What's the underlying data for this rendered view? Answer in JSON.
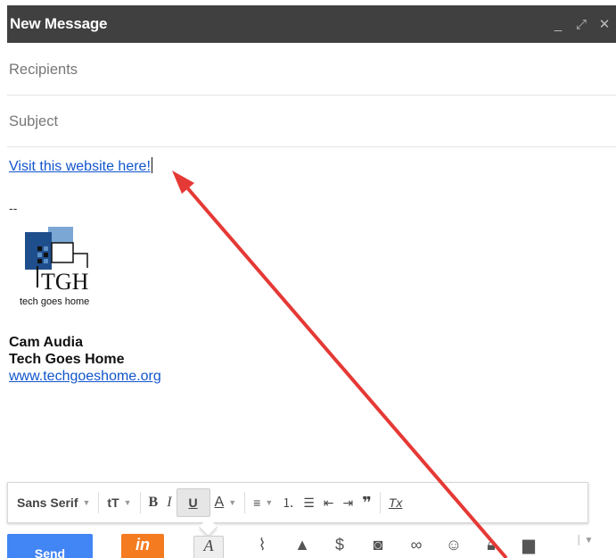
{
  "window": {
    "title": "New Message",
    "controls": {
      "minimize": "_",
      "expand": "⤢",
      "close": "✕"
    }
  },
  "compose": {
    "recipients_placeholder": "Recipients",
    "subject_placeholder": "Subject",
    "link_text": "Visit this website here!"
  },
  "signature": {
    "separator": "--",
    "logo_text": "TGH",
    "logo_subtitle": "tech goes home",
    "name": "Cam Audia",
    "org": "Tech Goes Home",
    "url": "www.techgoeshome.org"
  },
  "format_toolbar": {
    "font": "Sans Serif",
    "size_icon": "tT",
    "bold": "B",
    "italic": "I",
    "underline": "U",
    "text_color": "A",
    "clear_format": "Tx"
  },
  "bottom_toolbar": {
    "send": "Send",
    "in_button": "in",
    "format_toggle": "A",
    "icons": [
      "paperclip-icon",
      "drive-icon",
      "dollar-icon",
      "camera-icon",
      "link-icon",
      "emoji-icon",
      "lock-icon",
      "trash-icon",
      "more-options-icon"
    ]
  },
  "colors": {
    "titlebar": "#404040",
    "link": "#1155cc",
    "send": "#4285f4",
    "in_button": "#f47b20",
    "annotation_arrow": "#e53935"
  }
}
